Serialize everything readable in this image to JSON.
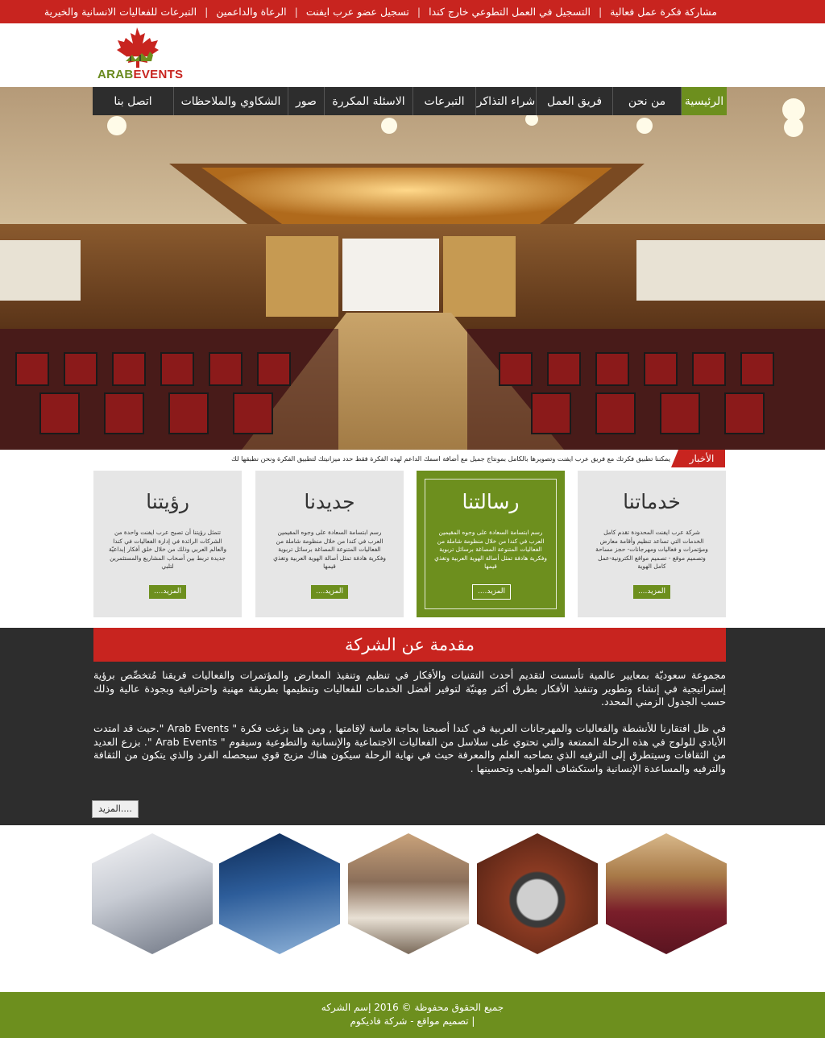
{
  "top_links": [
    "مشاركة فكرة عمل فعالية",
    "التسجيل في العمل التطوعي خارج كندا",
    "تسجيل عضو عرب ايفنت",
    "الرعاة والداعمين",
    "التبرعات للفعاليات الانسانية والخيرية"
  ],
  "logo": {
    "arab": "ARAB",
    "events": "EVENTS"
  },
  "nav": [
    "الرئيسية",
    "من نحن",
    "فريق العمل",
    "شراء التذاكر",
    "التبرعات",
    "الاسئلة المكررة",
    "صور",
    "الشكاوي والملاحظات",
    "اتصل بنا"
  ],
  "news": {
    "label": "الأخبار",
    "text": "يمكننا تطبيق فكرتك مع فريق عرب ايفنت وتصويرها بالكامل بمونتاج جميل  مع أضافة اسمك الداعم لهذه الفكرة فقط حدد ميزانيتك لتطبيق الفكرة ونحن نطبقها لك"
  },
  "boxes": [
    {
      "title": "خدماتنا",
      "text": "شركة عرب ايفنت المحدودة تقدم كامل الخدمات التي تساعد تنظيم وأقامة معارض ومؤتمرات و فعاليات ومهرجانات- حجز مساحة وتصميم موقع - تصميم مواقع الكترونية-عمل كامل الهوية",
      "more": "المزيد...."
    },
    {
      "title": "رسالتنا",
      "text": "رسم ابتسامة السعادة على وجوه المقيمين العرب في كندا من خلال منظومة شاملة من الفعاليات المتنوعة المصاغة برسائل تربوية وفكرية هادفة تمثل أصالة الهوية العربية وتغذي قيمها",
      "more": "المزيد...."
    },
    {
      "title": "جديدنا",
      "text": "رسم ابتسامة السعادة على وجوه المقيمين العرب في كندا من خلال منظومة شاملة من الفعاليات المتنوعة المصاغة برسائل تربوية وفكرية هادفة تمثل أصالة الهوية العربية وتغذي قيمها",
      "more": "المزيد...."
    },
    {
      "title": "رؤيتنا",
      "text": "تتمثل رؤيتنا أن تصبح عرب ايفنت واحدة من الشركات الرائدة في إدارة الفعاليات في كندا والعالم العربي وذلك من خلال خلق أفكار إبداعيّة جديدة تربط بين أصحاب المشاريع والمستثمرين لتلبي",
      "more": "المزيد...."
    }
  ],
  "about": {
    "title": "مقدمة عن الشركة",
    "p1": "مجموعة سعوديّة بمعايير عالمية تأسست لتقديم أحدث التقنيات والأفكار في تنظيم وتنفيذ المعارض والمؤتمرات والفعاليات فريقنا مُتخصِّص برؤية إستراتيجية في إنشاء وتطوير وتنفيذ الأفكار بطرق أكثر مِهنيّة لتوفير أفضل الخدمات للفعاليات وتنظيمها بطريقة مهنية واحترافية وبجودة عالية وذلك حسب الجدول الزمني المحدد.",
    "p2": "في ظل افتقارنا للأنشطة والفعاليات والمهرجانات العربية في كندا أصبحنا بحاجة ماسة لإقامتها , ومن هنا بزغت فكرة \" Arab Events \".حيث قد امتدت الأيادي للولوج في هذه الرحلة الممتعة والتي تحتوي على سلاسل من الفعاليات الاجتماعية والإنسانية والتطوعية وسيقوم \" Arab Events \". بزرع العديد من الثقافات وسيتطرق إلى الترفيه الذي يصاحبه العلم والمعرفة حيث في نهاية الرحلة سيكون هناك مزيج قوي سيحصله الفرد والذي يتكون من الثقافة والترفيه والمساعدة الإنسانية واستكشاف المواهب وتحسينها .",
    "more": "المزيد...."
  },
  "footer": {
    "line1": "جميع الحقوق محفوظة © 2016 إسم الشركه",
    "line2": "| تصميم مواقع - شركة فاديكوم"
  },
  "colors": {
    "red": "#c8241f",
    "green": "#6d8f1e",
    "dark": "#2d2d2d",
    "box": "#e6e6e6"
  }
}
